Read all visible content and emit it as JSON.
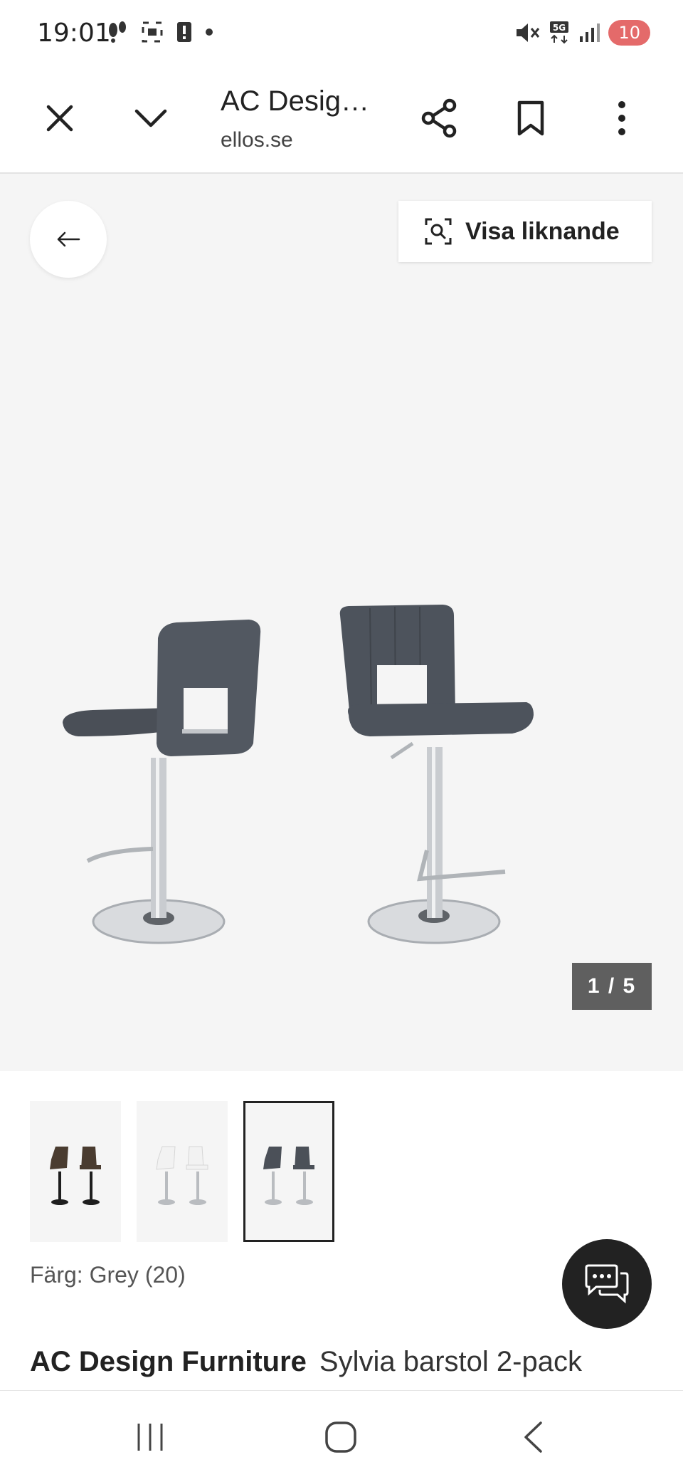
{
  "status": {
    "time": "19:01",
    "battery": "10",
    "network": "5G"
  },
  "toolbar": {
    "title": "AC Desig…",
    "url": "ellos.se",
    "icons": [
      "close-icon",
      "chevron-down-icon",
      "share-icon",
      "bookmark-icon",
      "more-vertical-icon"
    ]
  },
  "gallery": {
    "similar_label": "Visa liknande",
    "counter": "1 / 5",
    "current_image": 1,
    "total_images": 5
  },
  "thumbnails": [
    {
      "color": "brown",
      "seat": "#4a3c30",
      "frame": "#1b1b1b",
      "selected": false
    },
    {
      "color": "white",
      "seat": "#f2f2f2",
      "frame": "#b9bcc0",
      "selected": false
    },
    {
      "color": "grey",
      "seat": "#4b5058",
      "frame": "#b9bcc0",
      "selected": true
    }
  ],
  "product": {
    "color_label": "Färg: Grey (20)",
    "brand": "AC Design Furniture",
    "name": "Sylvia barstol 2-pack"
  },
  "colors": {
    "gallery_bg": "#f5f5f5",
    "counter_bg": "#5f5f5f",
    "chat_bg": "#222222"
  }
}
